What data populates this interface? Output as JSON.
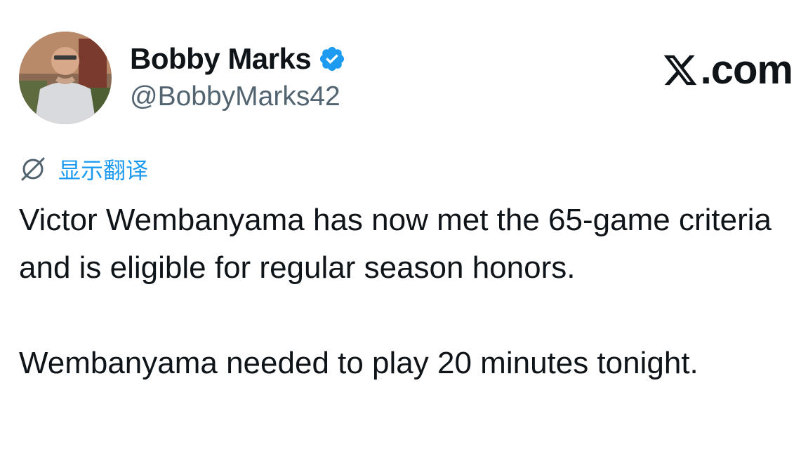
{
  "author": {
    "display_name": "Bobby Marks",
    "handle": "@BobbyMarks42",
    "verified": true
  },
  "brand": {
    "label": ".com",
    "icon": "x-logo-icon"
  },
  "translate": {
    "label": "显示翻译",
    "icon": "globe-slash-icon"
  },
  "tweet": {
    "paragraphs": [
      "Victor Wembanyama has now met the 65-game criteria and is eligible for regular season honors.",
      "Wembanyama needed to play 20 minutes tonight."
    ]
  },
  "colors": {
    "text": "#0f1419",
    "secondary": "#536471",
    "accent": "#1d9bf0"
  }
}
